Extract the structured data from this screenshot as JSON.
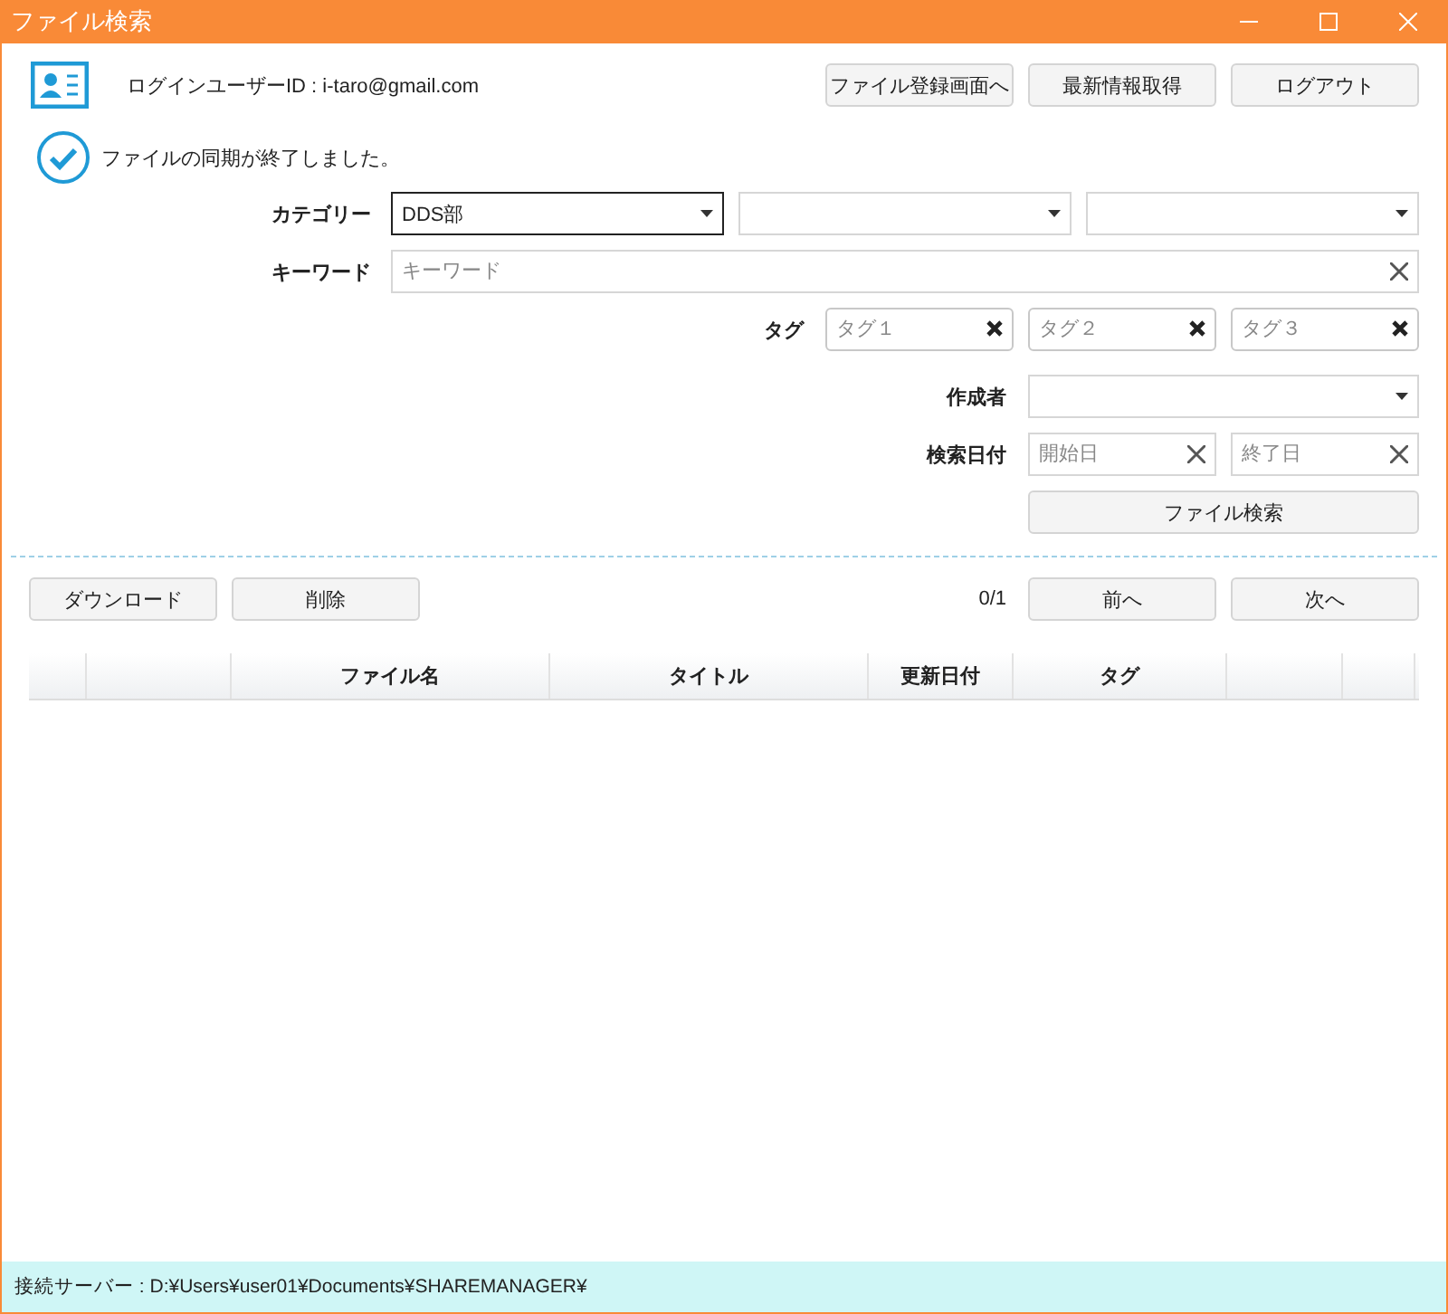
{
  "window": {
    "title": "ファイル検索"
  },
  "header": {
    "login": "ログインユーザーID : i-taro@gmail.com",
    "buttons": [
      "ファイル登録画面へ",
      "最新情報取得",
      "ログアウト"
    ]
  },
  "notice": "ファイルの同期が終了しました。",
  "form": {
    "category_label": "カテゴリー",
    "categories": [
      {
        "value": "DDS部",
        "focused": true
      },
      {
        "focused": false
      },
      {
        "focused": false
      }
    ],
    "keyword_label": "キーワード",
    "keyword_placeholder": "キーワード",
    "tag_label": "タグ",
    "tags": [
      {
        "placeholder": "タグ１"
      },
      {
        "placeholder": "タグ２"
      },
      {
        "placeholder": "タグ３"
      }
    ],
    "author_label": "作成者",
    "date_label": "検索日付",
    "dates": [
      {
        "placeholder": "開始日"
      },
      {
        "placeholder": "終了日"
      }
    ],
    "search_button": "ファイル検索"
  },
  "actions": {
    "buttons": [
      "ダウンロード",
      "削除"
    ],
    "page": "0/1",
    "nav": [
      "前へ",
      "次へ"
    ]
  },
  "table": {
    "columns": [
      {
        "kind": "blank"
      },
      {
        "kind": "blank"
      },
      {
        "kind": "text",
        "label": "ファイル名"
      },
      {
        "kind": "text",
        "label": "タイトル"
      },
      {
        "kind": "text",
        "label": "更新日付"
      },
      {
        "kind": "text",
        "label": "タグ"
      },
      {
        "kind": "blank"
      },
      {
        "kind": "blank"
      }
    ]
  },
  "status_bar": "接続サーバー : D:¥Users¥user01¥Documents¥SHAREMANAGER¥"
}
